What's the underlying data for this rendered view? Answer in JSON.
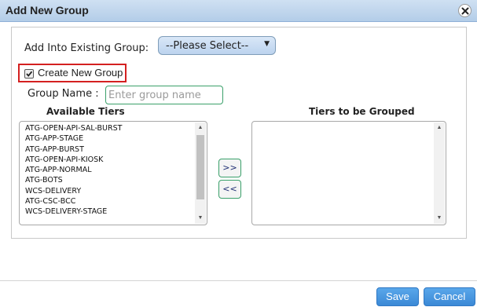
{
  "dialog": {
    "title": "Add New Group",
    "close_icon": "close-x-icon"
  },
  "form": {
    "existing_group_label": "Add Into Existing Group:",
    "existing_group_selected": "--Please Select--",
    "create_new_group_label": "Create New Group",
    "create_new_group_checked": true,
    "group_name_label": "Group Name :",
    "group_name_placeholder": "Enter group name",
    "group_name_value": ""
  },
  "available_tiers": {
    "heading": "Available Tiers",
    "items": [
      "ATG-OPEN-API-SAL-BURST",
      "ATG-APP-STAGE",
      "ATG-APP-BURST",
      "ATG-OPEN-API-KIOSK",
      "ATG-APP-NORMAL",
      "ATG-BOTS",
      "WCS-DELIVERY",
      "ATG-CSC-BCC",
      "WCS-DELIVERY-STAGE"
    ]
  },
  "grouped_tiers": {
    "heading": "Tiers to be Grouped",
    "items": []
  },
  "transfer": {
    "add_label": ">>",
    "remove_label": "<<"
  },
  "footer": {
    "save_label": "Save",
    "cancel_label": "Cancel"
  },
  "colors": {
    "accent": "#3b89d6",
    "highlight_border": "#d42020",
    "input_border": "#3aa06a"
  }
}
